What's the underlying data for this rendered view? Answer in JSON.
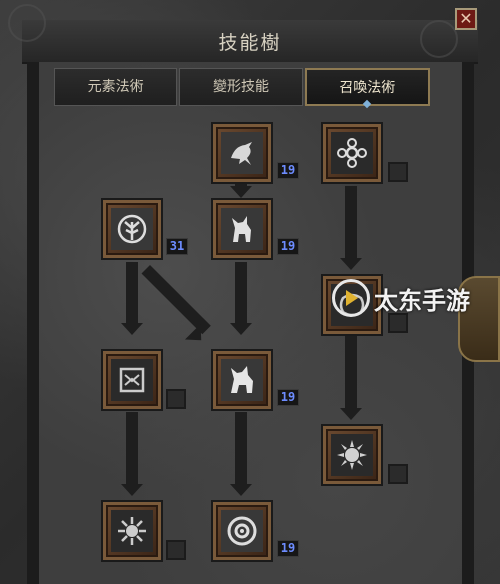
{
  "window": {
    "title": "技能樹",
    "close_label": "✕"
  },
  "tabs": [
    {
      "label": "元素法術",
      "active": false
    },
    {
      "label": "變形技能",
      "active": false
    },
    {
      "label": "召喚法術",
      "active": true
    }
  ],
  "skills": {
    "raven": {
      "icon": "raven-icon",
      "level": "19"
    },
    "spirit_wolf": {
      "icon": "wolf-icon",
      "level": "19"
    },
    "dire_wolf": {
      "icon": "dire-wolf-icon",
      "level": "19"
    },
    "grizzly": {
      "icon": "bear-icon",
      "level": "19"
    },
    "poison_creeper": {
      "icon": "tree-icon",
      "level": "31"
    },
    "carrion_vine": {
      "icon": "vine-icon",
      "level": ""
    },
    "solar_creeper": {
      "icon": "skull-sun-icon",
      "level": ""
    },
    "oak_sage": {
      "icon": "snowflake-icon",
      "level": ""
    },
    "heart_of_wolverine": {
      "icon": "heart-knot-icon",
      "level": ""
    },
    "spirit_of_barbs": {
      "icon": "sun-skull-icon",
      "level": ""
    }
  },
  "watermark": {
    "text": "太东手游"
  }
}
